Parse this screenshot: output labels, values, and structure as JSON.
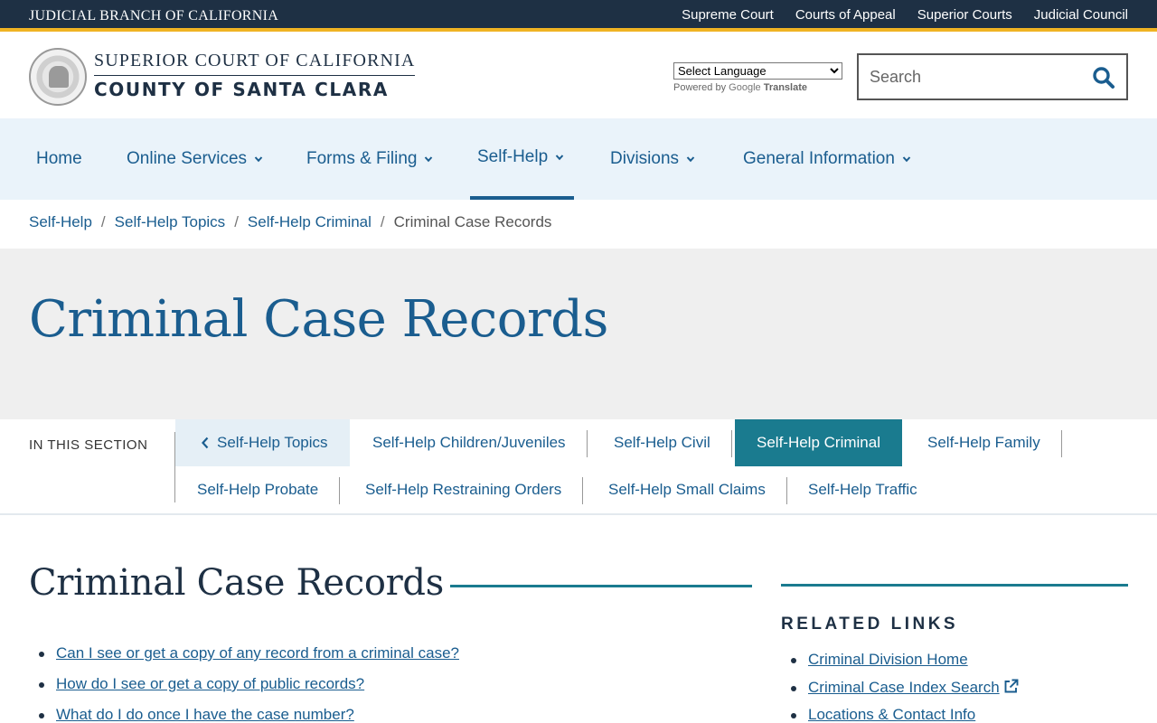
{
  "topbar": {
    "brand": "JUDICIAL BRANCH OF CALIFORNIA",
    "links": [
      "Supreme Court",
      "Courts of Appeal",
      "Superior Courts",
      "Judicial Council"
    ]
  },
  "header": {
    "court_line1": "SUPERIOR COURT OF CALIFORNIA",
    "court_line2": "COUNTY OF SANTA CLARA",
    "translate_select": "Select Language",
    "powered_by": "Powered by",
    "google": "Google",
    "translate": "Translate",
    "search_placeholder": "Search"
  },
  "nav": {
    "home": "Home",
    "online_services": "Online Services",
    "forms_filing": "Forms & Filing",
    "self_help": "Self-Help",
    "divisions": "Divisions",
    "general_information": "General Information"
  },
  "breadcrumb": {
    "c1": "Self-Help",
    "c2": "Self-Help Topics",
    "c3": "Self-Help Criminal",
    "current": "Criminal Case Records",
    "sep": "/"
  },
  "hero": {
    "title": "Criminal Case Records"
  },
  "section_nav": {
    "label": "IN THIS SECTION",
    "back": "Self-Help Topics",
    "items": [
      "Self-Help Children/Juveniles",
      "Self-Help Civil",
      "Self-Help Criminal",
      "Self-Help Family",
      "Self-Help Probate",
      "Self-Help Restraining Orders",
      "Self-Help Small Claims",
      "Self-Help Traffic"
    ]
  },
  "content": {
    "title": "Criminal Case Records",
    "links": [
      "Can I see or get a copy of any record from a criminal case?",
      "How do I see or get a copy of public records?",
      "What do I do once I have the case number?"
    ]
  },
  "sidebar": {
    "title": "RELATED LINKS",
    "links": [
      "Criminal Division Home",
      "Criminal Case Index Search",
      "Locations & Contact Info"
    ]
  },
  "colors": {
    "navy": "#1e3044",
    "gold": "#f0b323",
    "link_blue": "#1a5d8f",
    "teal": "#1a7b8f",
    "nav_bg": "#eaf3fa",
    "hero_bg": "#efefef"
  }
}
